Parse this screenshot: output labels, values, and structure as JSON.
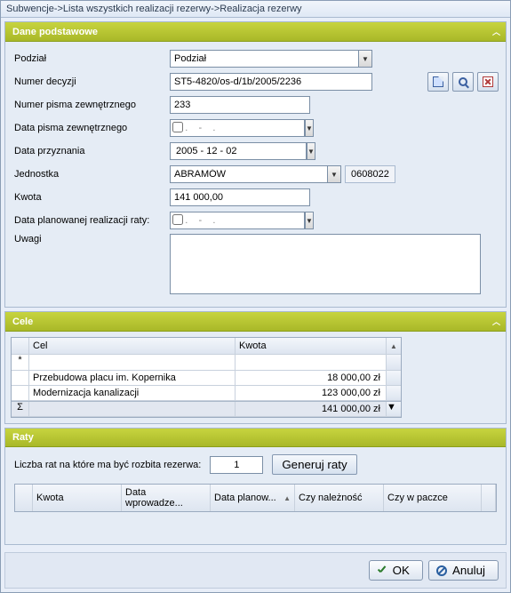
{
  "breadcrumb": "Subwencje->Lista wszystkich realizacji rezerwy->Realizacja rezerwy",
  "basic": {
    "title": "Dane podstawowe",
    "labels": {
      "podzial": "Podział",
      "numer_decyzji": "Numer decyzji",
      "numer_pisma": "Numer pisma zewnętrznego",
      "data_pisma": "Data pisma zewnętrznego",
      "data_przyznania": "Data przyznania",
      "jednostka": "Jednostka",
      "kwota": "Kwota",
      "data_plan": "Data planowanej realizacji raty:",
      "uwagi": "Uwagi"
    },
    "values": {
      "podzial": "Podział",
      "numer_decyzji": "ST5-4820/os-d/1b/2005/2236",
      "numer_pisma": "233",
      "data_pisma_empty": "    .    -    .",
      "data_przyznania": "2005 - 12 - 02",
      "jednostka": "ABRAMÓW",
      "jednostka_code": "0608022",
      "kwota": "141 000,00",
      "data_plan_empty": "    .    -    .",
      "uwagi": ""
    }
  },
  "cele": {
    "title": "Cele",
    "cols": {
      "cel": "Cel",
      "kwota": "Kwota"
    },
    "rows": [
      {
        "cel": "Przebudowa placu im. Kopernika",
        "kwota": "18 000,00 zł"
      },
      {
        "cel": "Modernizacja kanalizacji",
        "kwota": "123 000,00 zł"
      }
    ],
    "sum": "141 000,00 zł",
    "star": "*",
    "sigma": "Σ"
  },
  "raty": {
    "title": "Raty",
    "label": "Liczba rat na które ma być rozbita rezerwa:",
    "count": "1",
    "generate": "Generuj raty",
    "cols": {
      "kwota": "Kwota",
      "data_wprow": "Data wprowadze...",
      "data_plan": "Data planow...",
      "czy_nal": "Czy należność",
      "czy_paczka": "Czy w paczce"
    }
  },
  "footer": {
    "ok": "OK",
    "cancel": "Anuluj"
  }
}
